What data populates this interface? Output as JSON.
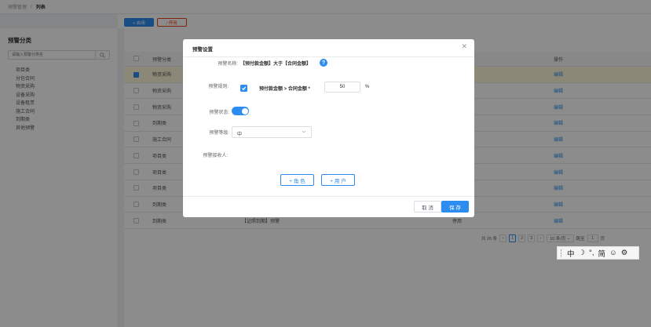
{
  "breadcrumb": {
    "parent": "预警管理",
    "current": "列表"
  },
  "toolbar": {
    "enable_label": "+ 启用",
    "disable_label": "⁄ 停用"
  },
  "sidebar": {
    "title": "预警分类",
    "search_placeholder": "请输入预警分类名",
    "items": [
      "项目类",
      "分包合同",
      "物资采购",
      "设备采购",
      "设备租赁",
      "施工合同",
      "到期类",
      "其他预警"
    ]
  },
  "table": {
    "headers": {
      "category": "预警分类",
      "operation": "操作"
    },
    "rows": [
      {
        "category": "物资采购",
        "name": "",
        "status": "",
        "op": "编辑",
        "selected": true
      },
      {
        "category": "物资采购",
        "name": "",
        "status": "",
        "op": "编辑",
        "selected": false
      },
      {
        "category": "物资采购",
        "name": "",
        "status": "",
        "op": "编辑",
        "selected": false
      },
      {
        "category": "到期类",
        "name": "",
        "status": "",
        "op": "编辑",
        "selected": false
      },
      {
        "category": "施工合同",
        "name": "",
        "status": "",
        "op": "编辑",
        "selected": false
      },
      {
        "category": "项目类",
        "name": "",
        "status": "",
        "op": "编辑",
        "selected": false
      },
      {
        "category": "项目类",
        "name": "",
        "status": "",
        "op": "编辑",
        "selected": false
      },
      {
        "category": "项目类",
        "name": "",
        "status": "",
        "op": "编辑",
        "selected": false
      },
      {
        "category": "到期类",
        "name": "",
        "status": "",
        "op": "编辑",
        "selected": false
      },
      {
        "category": "到期类",
        "name": "【证照到期】预警",
        "status": "停用",
        "op": "编辑",
        "selected": false
      }
    ]
  },
  "pagination": {
    "total": "共 26 条",
    "pages": [
      "1",
      "2",
      "3"
    ],
    "current_page": "1",
    "page_size": "10 条/页",
    "goto_label": "跳至",
    "goto_value": "1",
    "page_unit": "页"
  },
  "modal": {
    "title": "预警设置",
    "name_label": "预警名称:",
    "name_value": "【预付款金额】大于【合同金额】",
    "rule_label": "预警规则:",
    "rule_text": "预付款金额 > 合同金额 *",
    "rule_value": "50",
    "rule_unit": "%",
    "status_label": "预警状态:",
    "status_on": true,
    "level_label": "预警等级:",
    "level_value": "中",
    "receiver_label": "预警接收人:",
    "add_role_label": "+ 角 色",
    "add_user_label": "+ 用 户",
    "cancel_label": "取 消",
    "save_label": "保 存"
  },
  "ime_toolbar": {
    "items": [
      "中",
      "☽",
      "°,",
      "简",
      "☺",
      "⚙"
    ]
  },
  "colors": {
    "primary": "#2d8cf0",
    "danger": "#ed4014",
    "selected_row": "#fff7d9"
  }
}
